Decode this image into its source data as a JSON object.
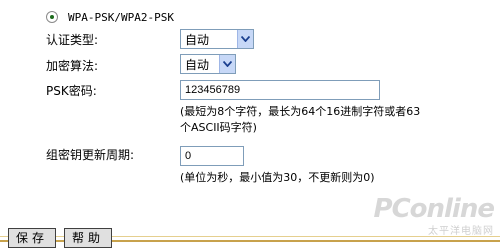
{
  "security": {
    "option_label": "WPA-PSK/WPA2-PSK",
    "auth_type_label": "认证类型:",
    "auth_type_value": "自动",
    "encryption_label": "加密算法:",
    "encryption_value": "自动",
    "psk_label": "PSK密码:",
    "psk_value": "123456789",
    "psk_note_line1": "(最短为8个字符，最长为64个16进制字符或者63",
    "psk_note_line2": "个ASCII码字符)",
    "rekey_label": "组密钥更新周期:",
    "rekey_value": "0",
    "rekey_note": "(单位为秒，最小值为30，不更新则为0)"
  },
  "footer": {
    "save_label": "保存",
    "help_label": "帮助"
  },
  "watermark": {
    "main": "PConline",
    "sub": "太平洋电脑网"
  }
}
